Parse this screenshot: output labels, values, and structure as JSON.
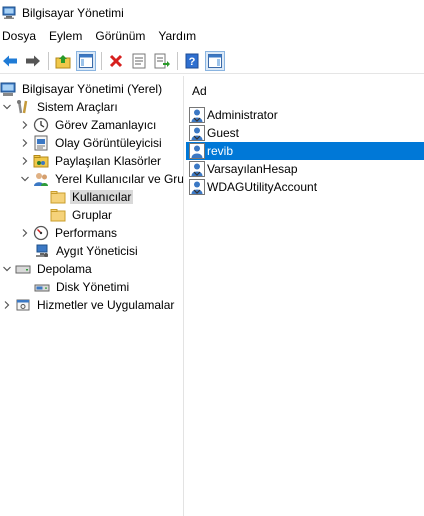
{
  "window": {
    "title": "Bilgisayar Yönetimi"
  },
  "menu": [
    "Dosya",
    "Eylem",
    "Görünüm",
    "Yardım"
  ],
  "toolbar": {
    "buttons": [
      "back-icon",
      "forward-icon",
      "up-folder-icon",
      "show-hide-console-tree-icon",
      "delete-icon",
      "properties-icon",
      "export-list-icon",
      "help-icon",
      "action-pane-icon"
    ]
  },
  "tree": {
    "root": "Bilgisayar Yönetimi (Yerel)",
    "system_tools": "Sistem Araçları",
    "task_scheduler": "Görev Zamanlayıcı",
    "event_viewer": "Olay Görüntüleyicisi",
    "shared_folders": "Paylaşılan Klasörler",
    "local_users": "Yerel Kullanıcılar ve Gru",
    "users": "Kullanıcılar",
    "groups": "Gruplar",
    "performance": "Performans",
    "device_manager": "Aygıt Yöneticisi",
    "storage": "Depolama",
    "disk_management": "Disk Yönetimi",
    "services": "Hizmetler ve Uygulamalar"
  },
  "list": {
    "column_header": "Ad",
    "users": [
      "Administrator",
      "Guest",
      "revib",
      "VarsayılanHesap",
      "WDAGUtilityAccount"
    ],
    "selected_user": "revib"
  },
  "colors": {
    "selection": "#0078d7",
    "tree_selection": "#d9d9d9"
  }
}
